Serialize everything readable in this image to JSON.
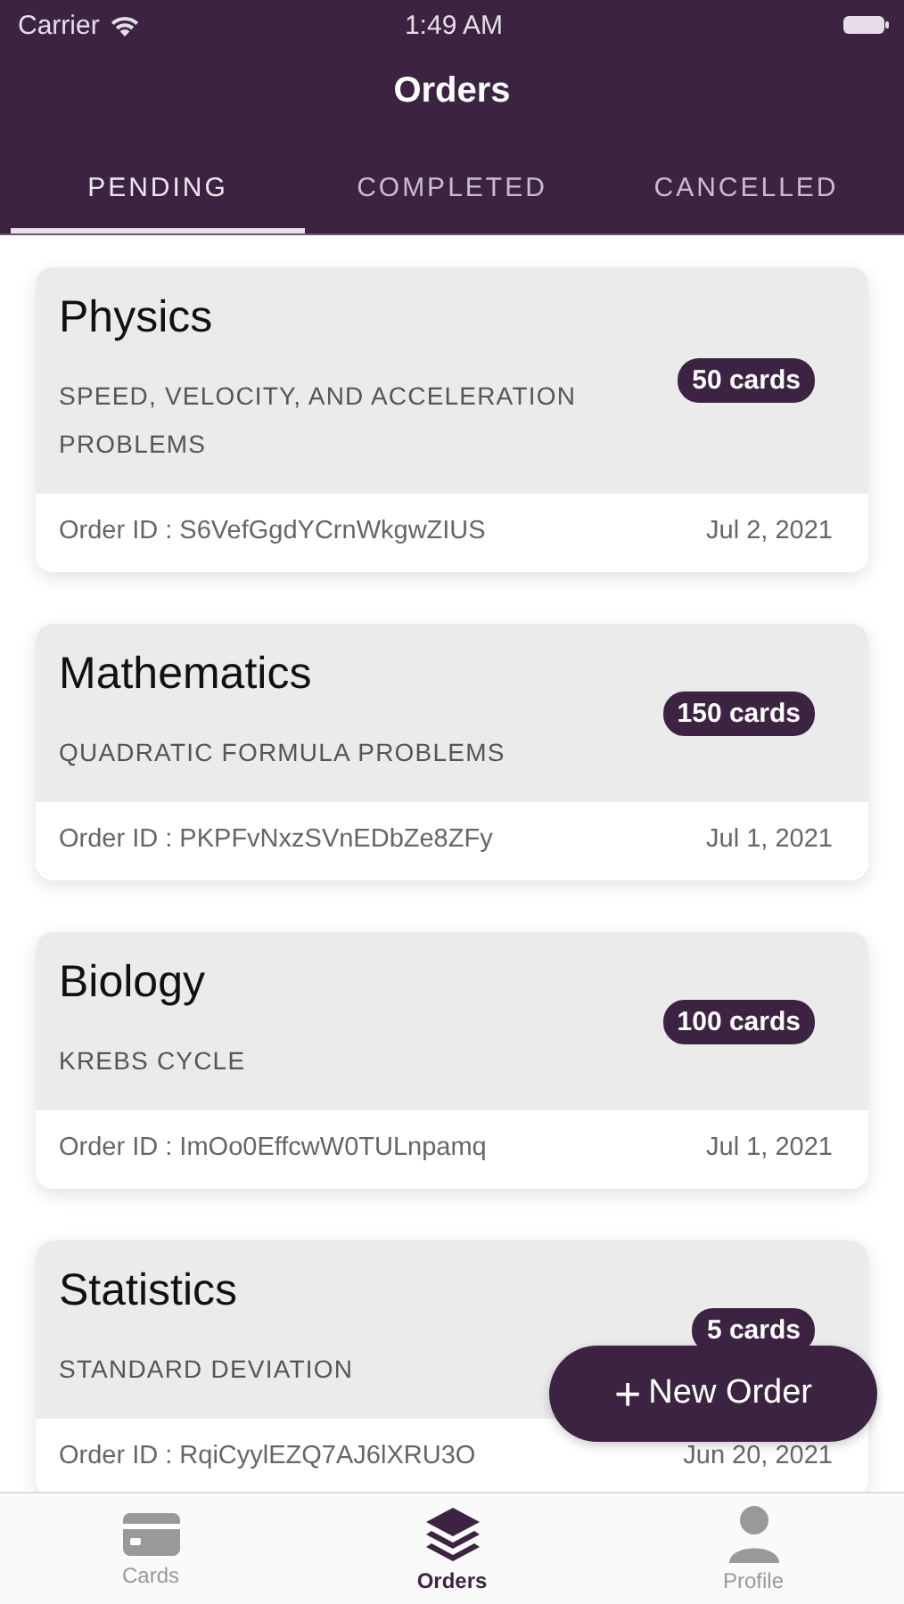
{
  "status_bar": {
    "carrier": "Carrier",
    "time": "1:49 AM"
  },
  "title": "Orders",
  "tabs": [
    {
      "label": "PENDING",
      "selected": true
    },
    {
      "label": "COMPLETED",
      "selected": false
    },
    {
      "label": "CANCELLED",
      "selected": false
    }
  ],
  "orders": [
    {
      "subject": "Physics",
      "topic": "SPEED, VELOCITY, AND ACCELERATION PROBLEMS",
      "count": "50 cards",
      "order_id": "Order ID : S6VefGgdYCrnWkgwZIUS",
      "date": "Jul 2, 2021"
    },
    {
      "subject": "Mathematics",
      "topic": "QUADRATIC FORMULA PROBLEMS",
      "count": "150 cards",
      "order_id": "Order ID : PKPFvNxzSVnEDbZe8ZFy",
      "date": "Jul 1, 2021"
    },
    {
      "subject": "Biology",
      "topic": "KREBS CYCLE",
      "count": "100 cards",
      "order_id": "Order ID : ImOo0EffcwW0TULnpamq",
      "date": "Jul 1, 2021"
    },
    {
      "subject": "Statistics",
      "topic": "STANDARD DEVIATION",
      "count": "5 cards",
      "order_id": "Order ID : RqiCyylEZQ7AJ6lXRU3O",
      "date": "Jun 20, 2021"
    }
  ],
  "fab": {
    "icon": "+",
    "label": "New Order"
  },
  "bottom_tabs": [
    {
      "kind": "card",
      "label": "Cards",
      "selected": false
    },
    {
      "kind": "layers",
      "label": "Orders",
      "selected": true
    },
    {
      "kind": "person",
      "label": "Profile",
      "selected": false
    }
  ]
}
